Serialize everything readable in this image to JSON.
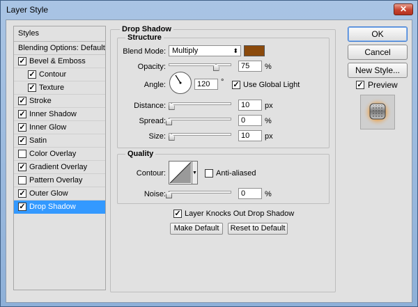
{
  "window": {
    "title": "Layer Style",
    "close_glyph": "✕"
  },
  "styles_panel": {
    "header": "Styles",
    "blending_options": "Blending Options: Default",
    "items": [
      {
        "label": "Bevel & Emboss",
        "checked": true,
        "indent": 0,
        "selected": false
      },
      {
        "label": "Contour",
        "checked": true,
        "indent": 1,
        "selected": false
      },
      {
        "label": "Texture",
        "checked": true,
        "indent": 1,
        "selected": false
      },
      {
        "label": "Stroke",
        "checked": true,
        "indent": 0,
        "selected": false
      },
      {
        "label": "Inner Shadow",
        "checked": true,
        "indent": 0,
        "selected": false
      },
      {
        "label": "Inner Glow",
        "checked": true,
        "indent": 0,
        "selected": false
      },
      {
        "label": "Satin",
        "checked": true,
        "indent": 0,
        "selected": false
      },
      {
        "label": "Color Overlay",
        "checked": false,
        "indent": 0,
        "selected": false
      },
      {
        "label": "Gradient Overlay",
        "checked": true,
        "indent": 0,
        "selected": false
      },
      {
        "label": "Pattern Overlay",
        "checked": false,
        "indent": 0,
        "selected": false
      },
      {
        "label": "Outer Glow",
        "checked": true,
        "indent": 0,
        "selected": false
      },
      {
        "label": "Drop Shadow",
        "checked": true,
        "indent": 0,
        "selected": true
      }
    ]
  },
  "drop_shadow": {
    "title": "Drop Shadow",
    "structure": {
      "title": "Structure",
      "blend_mode_label": "Blend Mode:",
      "blend_mode_value": "Multiply",
      "shadow_color": "#8b4a0c",
      "opacity_label": "Opacity:",
      "opacity_value": "75",
      "opacity_unit": "%",
      "opacity_level": 0.75,
      "angle_label": "Angle:",
      "angle_value": "120",
      "angle_unit": "°",
      "use_global_light_label": "Use Global Light",
      "use_global_light": true,
      "distance_label": "Distance:",
      "distance_value": "10",
      "distance_unit": "px",
      "distance_level": 0.04,
      "spread_label": "Spread:",
      "spread_value": "0",
      "spread_unit": "%",
      "spread_level": 0,
      "size_label": "Size:",
      "size_value": "10",
      "size_unit": "px",
      "size_level": 0.04
    },
    "quality": {
      "title": "Quality",
      "contour_label": "Contour:",
      "anti_aliased_label": "Anti-aliased",
      "anti_aliased": false,
      "noise_label": "Noise:",
      "noise_value": "0",
      "noise_unit": "%",
      "noise_level": 0
    },
    "knockout_label": "Layer Knocks Out Drop Shadow",
    "knockout_checked": true,
    "make_default_label": "Make Default",
    "reset_default_label": "Reset to Default"
  },
  "actions": {
    "ok_label": "OK",
    "cancel_label": "Cancel",
    "new_style_label": "New Style...",
    "preview_label": "Preview",
    "preview_checked": true
  }
}
